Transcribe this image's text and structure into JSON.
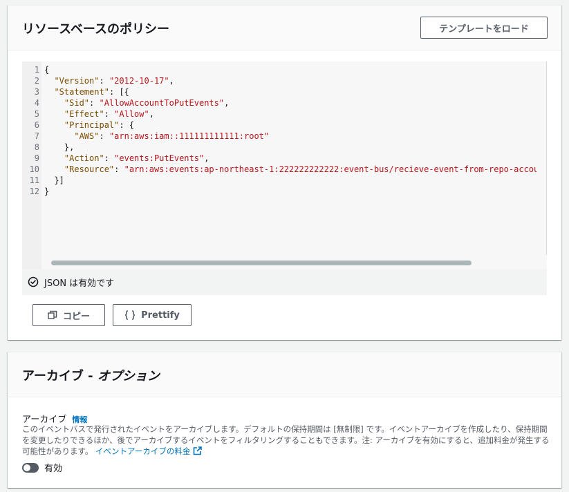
{
  "policy_panel": {
    "title": "リソースベースのポリシー",
    "template_button": "テンプレートをロード",
    "editor": {
      "line_numbers": [
        "1",
        "2",
        "3",
        "4",
        "5",
        "6",
        "7",
        "8",
        "9",
        "10",
        "11",
        "12"
      ],
      "lines": [
        [
          {
            "t": "p",
            "v": "{"
          }
        ],
        [
          {
            "t": "p",
            "v": "  "
          },
          {
            "t": "k",
            "v": "\"Version\""
          },
          {
            "t": "p",
            "v": ": "
          },
          {
            "t": "s",
            "v": "\"2012-10-17\""
          },
          {
            "t": "p",
            "v": ","
          }
        ],
        [
          {
            "t": "p",
            "v": "  "
          },
          {
            "t": "k",
            "v": "\"Statement\""
          },
          {
            "t": "p",
            "v": ": [{"
          }
        ],
        [
          {
            "t": "p",
            "v": "    "
          },
          {
            "t": "k",
            "v": "\"Sid\""
          },
          {
            "t": "p",
            "v": ": "
          },
          {
            "t": "s",
            "v": "\"AllowAccountToPutEvents\""
          },
          {
            "t": "p",
            "v": ","
          }
        ],
        [
          {
            "t": "p",
            "v": "    "
          },
          {
            "t": "k",
            "v": "\"Effect\""
          },
          {
            "t": "p",
            "v": ": "
          },
          {
            "t": "s",
            "v": "\"Allow\""
          },
          {
            "t": "p",
            "v": ","
          }
        ],
        [
          {
            "t": "p",
            "v": "    "
          },
          {
            "t": "k",
            "v": "\"Principal\""
          },
          {
            "t": "p",
            "v": ": {"
          }
        ],
        [
          {
            "t": "p",
            "v": "      "
          },
          {
            "t": "k",
            "v": "\"AWS\""
          },
          {
            "t": "p",
            "v": ": "
          },
          {
            "t": "s",
            "v": "\"arn:aws:iam::111111111111:root\""
          }
        ],
        [
          {
            "t": "p",
            "v": "    },"
          }
        ],
        [
          {
            "t": "p",
            "v": "    "
          },
          {
            "t": "k",
            "v": "\"Action\""
          },
          {
            "t": "p",
            "v": ": "
          },
          {
            "t": "s",
            "v": "\"events:PutEvents\""
          },
          {
            "t": "p",
            "v": ","
          }
        ],
        [
          {
            "t": "p",
            "v": "    "
          },
          {
            "t": "k",
            "v": "\"Resource\""
          },
          {
            "t": "p",
            "v": ": "
          },
          {
            "t": "s",
            "v": "\"arn:aws:events:ap-northeast-1:222222222222:event-bus/recieve-event-from-repo-accou"
          }
        ],
        [
          {
            "t": "p",
            "v": "  }]"
          }
        ],
        [
          {
            "t": "p",
            "v": "}"
          }
        ]
      ]
    },
    "validation_text": "JSON は有効です",
    "copy_button": "コピー",
    "prettify_button": "Prettify"
  },
  "archive_panel": {
    "title_main": "アーカイブ - ",
    "title_italic": "オプション",
    "field_label": "アーカイブ",
    "info_link": "情報",
    "description": "このイベントバスで発行されたイベントをアーカイブします。デフォルトの保持期間は [無制限] です。イベントアーカイブを作成したり、保持期間を変更したりできるほか、後でアーカイブするイベントをフィルタリングすることもできます。注: アーカイブを有効にすると、追加料金が発生する可能性があります。",
    "pricing_link": "イベントアーカイブの料金",
    "toggle_label": "有効",
    "toggle_enabled": false
  },
  "colors": {
    "accent_link": "#0073bb",
    "code_key": "#7c4d00",
    "code_string": "#b8141a",
    "button_border": "#545b64"
  }
}
